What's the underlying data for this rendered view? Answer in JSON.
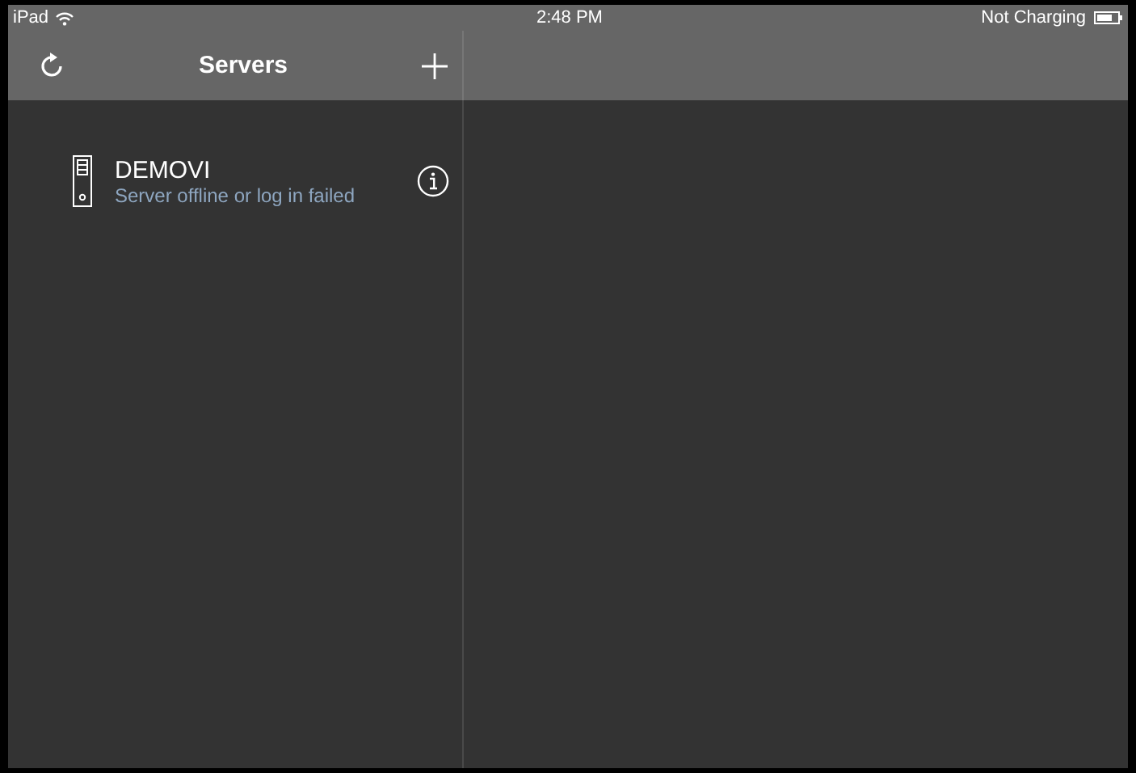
{
  "status_bar": {
    "device": "iPad",
    "time": "2:48 PM",
    "battery_text": "Not Charging"
  },
  "nav_bar": {
    "title": "Servers"
  },
  "servers": [
    {
      "name": "DEMOVI",
      "status": "Server offline or log in failed"
    }
  ]
}
